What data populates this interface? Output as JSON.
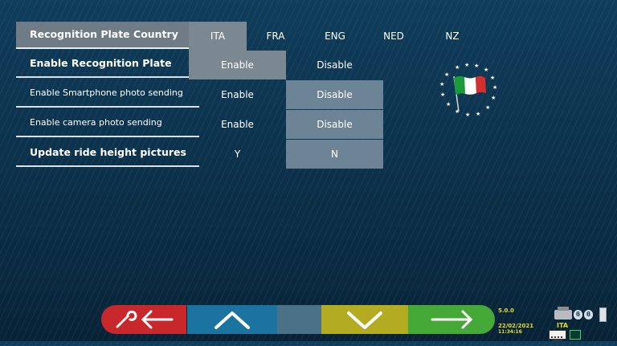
{
  "settings": {
    "country_label": "Recognition Plate Country",
    "countries": [
      "ITA",
      "FRA",
      "ENG",
      "NED",
      "NZ"
    ],
    "selected_country": "ITA",
    "rows": [
      {
        "label": "Enable Recognition Plate",
        "option_a": "Enable",
        "option_b": "Disable",
        "selected": "Enable"
      },
      {
        "label": "Enable Smartphone photo sending",
        "option_a": "Enable",
        "option_b": "Disable",
        "selected": "Disable"
      },
      {
        "label": "Enable camera photo sending",
        "option_a": "Enable",
        "option_b": "Disable",
        "selected": "Disable"
      },
      {
        "label": "Update ride height pictures",
        "option_a": "Y",
        "option_b": "N",
        "selected": "N"
      }
    ]
  },
  "flag": {
    "icon": "italy-flag-icon",
    "colors": [
      "#1a9a3a",
      "#ffffff",
      "#d32f2f"
    ]
  },
  "toolbar": {
    "buttons": [
      {
        "name": "tools-back-button",
        "color": "#c8282b",
        "icon": "wrench-and-left-arrow-icon"
      },
      {
        "name": "up-button",
        "color": "#1b73a0",
        "icon": "chevron-up-icon"
      },
      {
        "name": "blank-button",
        "color": "#4b7186",
        "icon": ""
      },
      {
        "name": "down-button",
        "color": "#b3ac22",
        "icon": "chevron-down-icon"
      },
      {
        "name": "next-button",
        "color": "#45a937",
        "icon": "right-arrow-icon"
      }
    ]
  },
  "status": {
    "version": "5.0.0",
    "date": "22/02/2021",
    "time": "11:34:16",
    "country": "ITA",
    "icons": [
      "printer-icon",
      "bluetooth-icon",
      "bluetooth-icon",
      "battery-icon",
      "keyboard-icon",
      "network-icon"
    ]
  }
}
